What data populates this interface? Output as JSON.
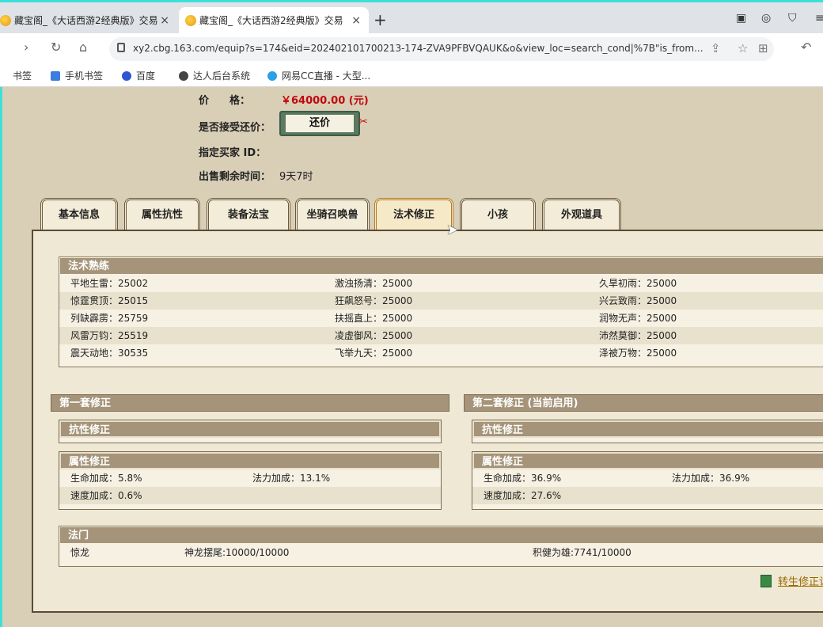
{
  "browser": {
    "tabs": [
      {
        "title": "藏宝阁_《大话西游2经典版》交易",
        "close": "×"
      },
      {
        "title": "藏宝阁_《大话西游2经典版》交易",
        "close": "×"
      }
    ],
    "new_tab": "+",
    "url": "xy2.cbg.163.com/equip?s=174&eid=202402101700213-174-ZVA9PFBVQAUK&o&view_loc=search_cond|%7B\"is_from...",
    "bookmarks": [
      "书签",
      "手机书签",
      "百度",
      "达人后台系统",
      "网易CC直播 - 大型..."
    ]
  },
  "listing": {
    "price_label": "价　　格：",
    "price_value": "￥64000.00 (元)",
    "counter_label": "是否接受还价：",
    "counter_button": "还价",
    "buyer_label": "指定买家 ID：",
    "time_label": "出售剩余时间：",
    "time_value": "9天7时"
  },
  "tabs": [
    "基本信息",
    "属性抗性",
    "装备法宝",
    "坐骑召唤兽",
    "法术修正",
    "小孩",
    "外观道具"
  ],
  "active_tab": "法术修正",
  "spell_mastery": {
    "title": "法术熟练",
    "rows": [
      [
        "平地生雷：25002",
        "激浊扬清：25000",
        "久旱初雨：25000"
      ],
      [
        "惊霆贯顶：25015",
        "狂飙怒号：25000",
        "兴云致雨：25000"
      ],
      [
        "列缺霹雳：25759",
        "扶摇直上：25000",
        "润物无声：25000"
      ],
      [
        "风雷万钧：25519",
        "凌虚御风：25000",
        "沛然莫御：25000"
      ],
      [
        "震天动地：30535",
        "飞举九天：25000",
        "泽被万物：25000"
      ]
    ]
  },
  "set1": {
    "title": "第一套修正",
    "resist_title": "抗性修正",
    "attr_title": "属性修正",
    "attrs": [
      [
        "生命加成：5.8%",
        "法力加成：13.1%"
      ],
      [
        "速度加成：0.6%",
        ""
      ]
    ]
  },
  "set2": {
    "title": "第二套修正 (当前启用)",
    "resist_title": "抗性修正",
    "attr_title": "属性修正",
    "attrs": [
      [
        "生命加成：36.9%",
        "法力加成：36.9%"
      ],
      [
        "速度加成：27.6%",
        ""
      ]
    ]
  },
  "faction": {
    "title": "法门",
    "row": [
      "惊龙",
      "神龙摆尾:10000/10000",
      "积健为雄:7741/10000"
    ]
  },
  "reincarnation_link": "转生修正计"
}
